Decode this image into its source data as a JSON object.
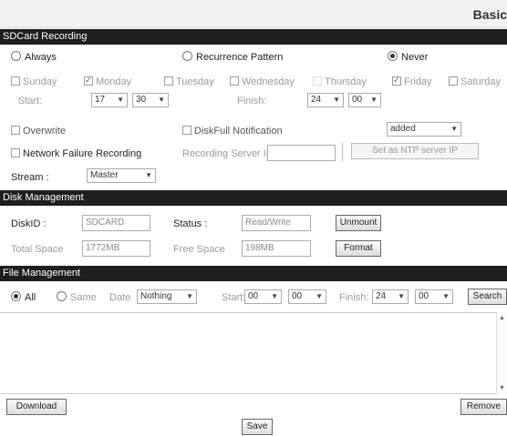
{
  "header": {
    "title": "Basic"
  },
  "sd_recording": {
    "section_title": "SDCard Recording",
    "modes": [
      {
        "label": "Always",
        "selected": false
      },
      {
        "label": "Recurrence Pattern",
        "selected": false
      },
      {
        "label": "Never",
        "selected": true
      }
    ],
    "days": [
      {
        "label": "Sunday",
        "checked": false
      },
      {
        "label": "Monday",
        "checked": true
      },
      {
        "label": "Tuesday",
        "checked": false
      },
      {
        "label": "Wednesday",
        "checked": false
      },
      {
        "label": "Thursday",
        "checked": false
      },
      {
        "label": "Friday",
        "checked": true
      },
      {
        "label": "Saturday",
        "checked": false
      }
    ],
    "start_label": "Start:",
    "start_hour": "17",
    "start_min": "30",
    "finish_label": "Finish:",
    "finish_hour": "24",
    "finish_min": "00",
    "overwrite_label": "Overwrite",
    "diskfull_label": "DiskFull Notification",
    "notify_value": "added",
    "netfail_label": "Network Failure Recording",
    "server_ip_label": "Recording Server IP",
    "server_ip_value": "",
    "ntp_button": "Set as NTP server IP",
    "stream_label": "Stream :",
    "stream_value": "Master"
  },
  "disk": {
    "section_title": "Disk Management",
    "diskid_label": "DiskID :",
    "diskid_value": "SDCARD",
    "status_label": "Status :",
    "status_value": "Read/Write",
    "unmount_button": "Unmount",
    "total_label": "Total Space",
    "total_value": "1772MB",
    "free_label": "Free Space",
    "free_value": "198MB",
    "format_button": "Format"
  },
  "files": {
    "section_title": "File Management",
    "all_label": "All",
    "same_label": "Same",
    "date_label": "Date",
    "date_value": "Nothing",
    "start_label": "Start:",
    "start_hour": "00",
    "start_min": "00",
    "finish_label": "Finish:",
    "finish_hour": "24",
    "finish_min": "00",
    "search_button": "Search",
    "download_button": "Download",
    "remove_button": "Remove"
  },
  "footer": {
    "save_button": "Save"
  }
}
